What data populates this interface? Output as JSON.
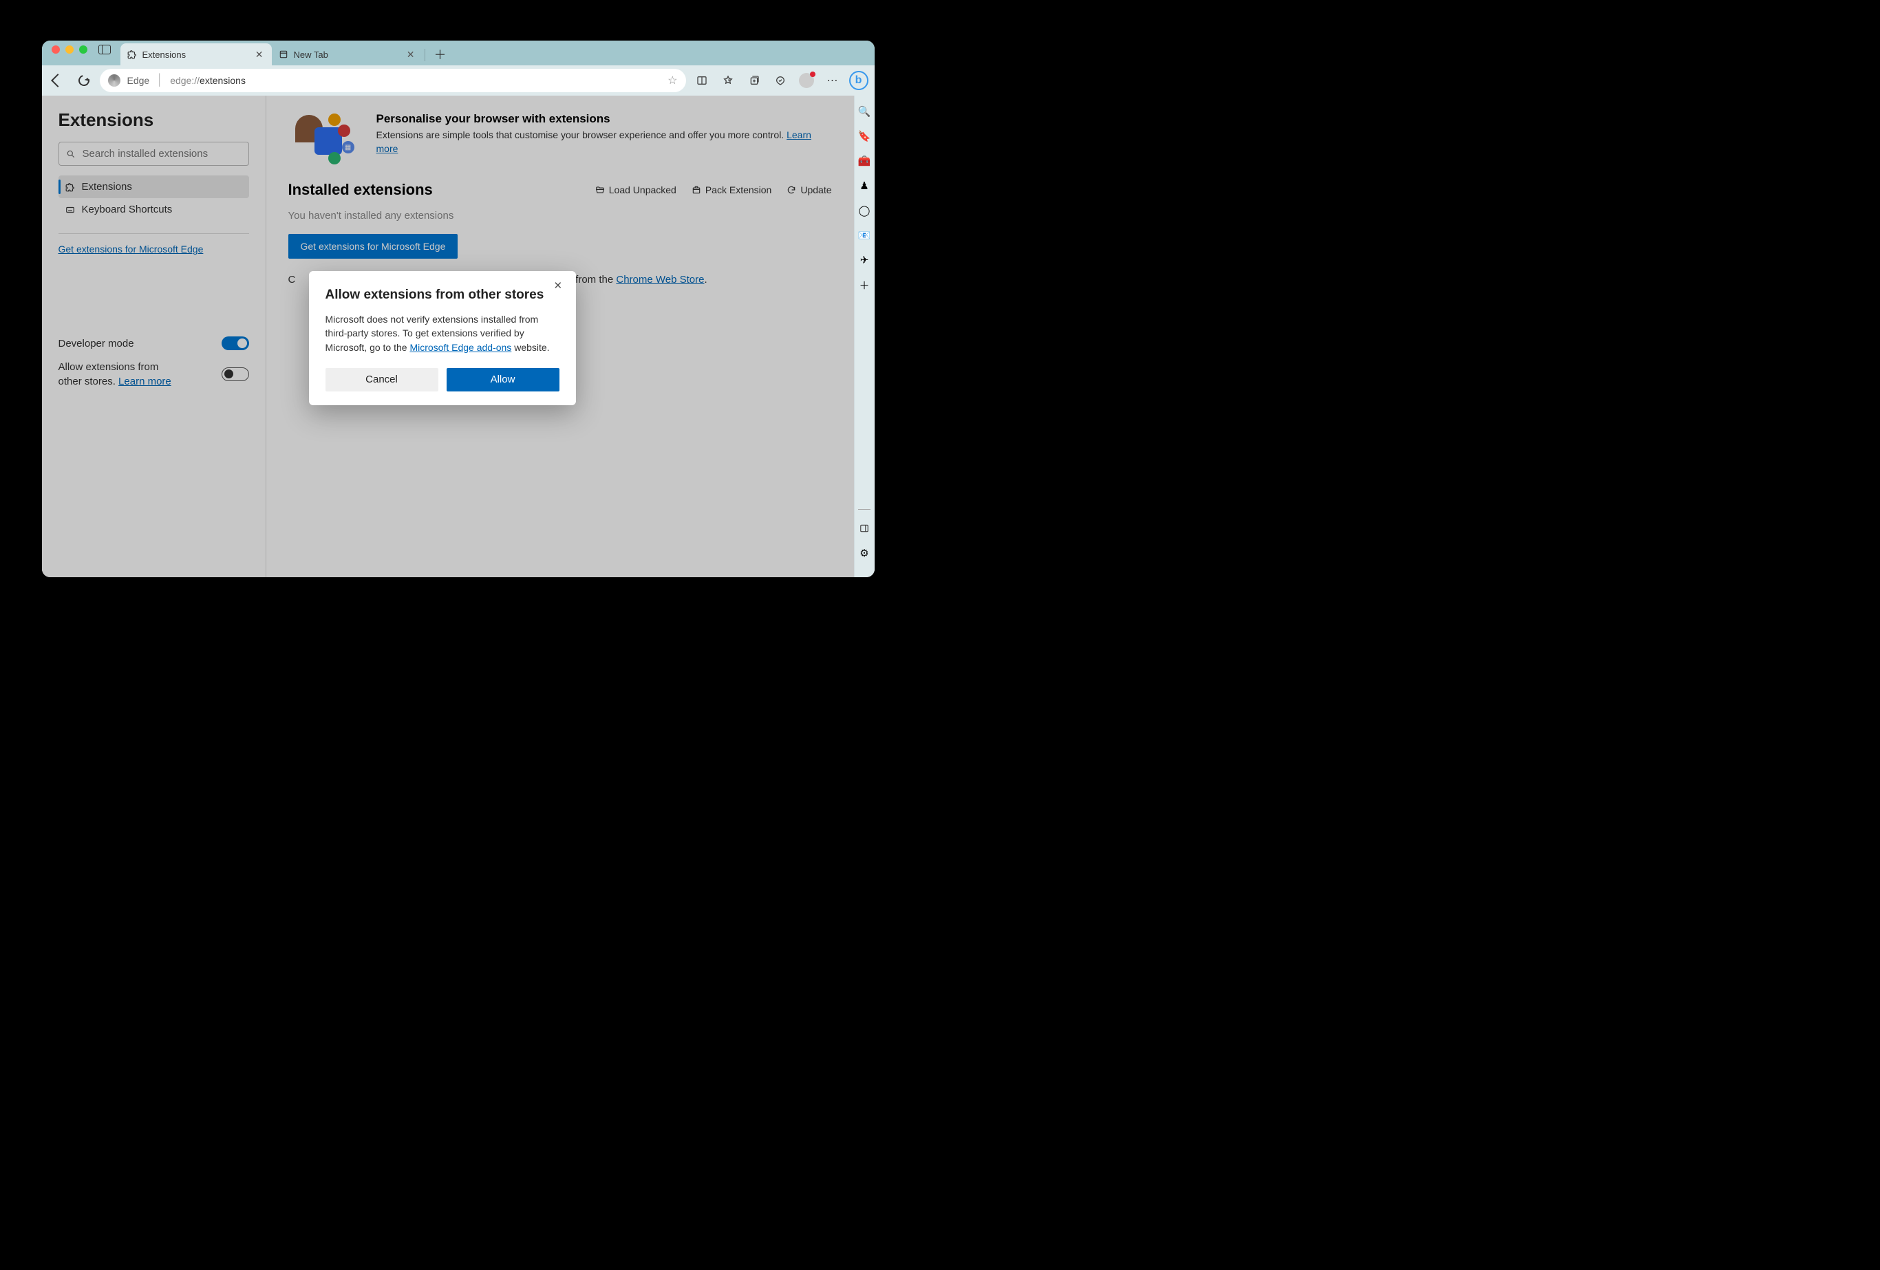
{
  "tabs": {
    "active": {
      "title": "Extensions"
    },
    "other": {
      "title": "New Tab"
    }
  },
  "toolbar": {
    "edge_label": "Edge",
    "url_prefix": "edge://",
    "url_path": "extensions"
  },
  "sidebar": {
    "title": "Extensions",
    "search_placeholder": "Search installed extensions",
    "items": [
      {
        "label": "Extensions"
      },
      {
        "label": "Keyboard Shortcuts"
      }
    ],
    "store_link": "Get extensions for Microsoft Edge",
    "dev_mode_label": "Developer mode",
    "allow_other_label_pre": "Allow extensions from other stores. ",
    "learn_more": "Learn more"
  },
  "main": {
    "hero_title": "Personalise your browser with extensions",
    "hero_text": "Extensions are simple tools that customise your browser experience and offer you more control. ",
    "learn_more": "Learn more",
    "installed_title": "Installed extensions",
    "load_unpacked": "Load Unpacked",
    "pack_ext": "Pack Extension",
    "update": "Update",
    "none_text": "You haven't installed any extensions",
    "get_btn": "Get extensions for Microsoft Edge",
    "chrome_text_pre": "C",
    "chrome_text_post": " from the ",
    "chrome_link": "Chrome Web Store",
    "dot": "."
  },
  "modal": {
    "title": "Allow extensions from other stores",
    "text_pre": "Microsoft does not verify extensions installed from third-party stores. To get extensions verified by Microsoft, go to the ",
    "link": "Microsoft Edge add-ons",
    "text_post": " website.",
    "cancel": "Cancel",
    "allow": "Allow"
  }
}
